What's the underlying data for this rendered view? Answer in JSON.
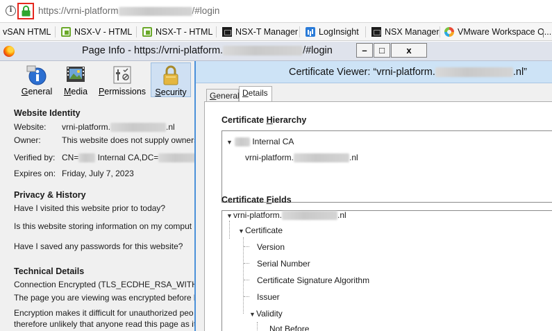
{
  "urlbar": {
    "url_prefix": "https://vrni-platform",
    "url_suffix": "/#login"
  },
  "bookmarks": [
    {
      "label": "vSAN HTML",
      "icon": "none"
    },
    {
      "label": "NSX-V - HTML",
      "icon": "nsx-icon"
    },
    {
      "label": "NSX-T - HTML",
      "icon": "nsx-icon"
    },
    {
      "label": "NSX-T Manager",
      "icon": "vmware-icon"
    },
    {
      "label": "LogInsight",
      "icon": "loginsight-icon"
    },
    {
      "label": "NSX Manager",
      "icon": "vmware-icon"
    },
    {
      "label": "VMware Workspace O...",
      "icon": "workspace-one-icon"
    }
  ],
  "page_info": {
    "title_prefix": "Page Info - https://vrni-platform.",
    "title_suffix": "/#login",
    "window_buttons": {
      "minimize": "–",
      "maximize": "□",
      "close": "x"
    },
    "toolbar": [
      {
        "label_pre": "",
        "label_key": "G",
        "label_post": "eneral",
        "icon": "info-icon"
      },
      {
        "label_pre": "",
        "label_key": "M",
        "label_post": "edia",
        "icon": "media-icon"
      },
      {
        "label_pre": "",
        "label_key": "P",
        "label_post": "ermissions",
        "icon": "permissions-icon"
      },
      {
        "label_pre": "",
        "label_key": "S",
        "label_post": "ecurity",
        "icon": "padlock-icon"
      }
    ],
    "website_identity": {
      "heading": "Website Identity",
      "website_label": "Website:",
      "website_value_prefix": "vrni-platform.",
      "website_value_suffix": ".nl",
      "owner_label": "Owner:",
      "owner_value": "This website does not supply owners",
      "verified_label": "Verified by:",
      "verified_prefix": "CN=",
      "verified_middle": " Internal CA,DC=",
      "expires_label": "Expires on:",
      "expires_value": "Friday, July 7, 2023"
    },
    "privacy": {
      "heading": "Privacy & History",
      "q1": "Have I visited this website prior to today?",
      "q2": "Is this website storing information on my comput",
      "q3": "Have I saved any passwords for this website?"
    },
    "technical": {
      "heading": "Technical Details",
      "line1": "Connection Encrypted (TLS_ECDHE_RSA_WITH_A",
      "line2": "The page you are viewing was encrypted before b",
      "line3": "Encryption makes it difficult for unauthorized peo",
      "line4": "therefore unlikely that anyone read this page as it"
    }
  },
  "cert_viewer": {
    "title_prefix": "Certificate Viewer: “vrni-platform.",
    "title_suffix": ".nl”",
    "tabs": [
      {
        "label_key": "G",
        "label_post": "eneral",
        "selected": false
      },
      {
        "label_key": "D",
        "label_post": "etails",
        "selected": true
      }
    ],
    "hierarchy_heading_pre": "Certificate ",
    "hierarchy_heading_key": "H",
    "hierarchy_heading_post": "ierarchy",
    "hierarchy": {
      "root": "Internal CA",
      "leaf_prefix": "vrni-platform.",
      "leaf_suffix": ".nl"
    },
    "fields_heading_pre": "Certificate ",
    "fields_heading_key": "F",
    "fields_heading_post": "ields",
    "fields": {
      "root_prefix": "vrni-platform.",
      "root_suffix": ".nl",
      "certificate": "Certificate",
      "version": "Version",
      "serial": "Serial Number",
      "sig_alg": "Certificate Signature Algorithm",
      "issuer": "Issuer",
      "validity": "Validity",
      "not_before": "Not Before"
    }
  }
}
